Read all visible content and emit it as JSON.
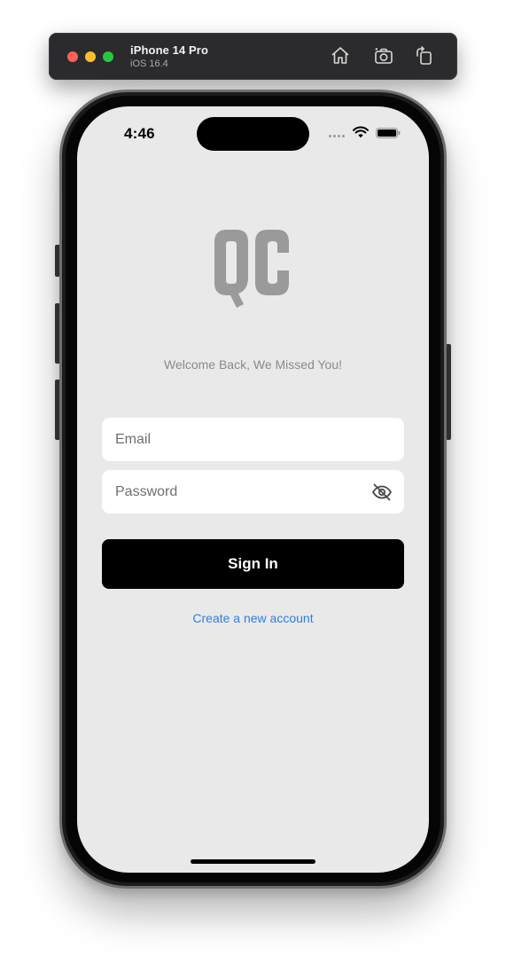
{
  "simulator": {
    "device_name": "iPhone 14 Pro",
    "os_version": "iOS 16.4",
    "tools": [
      "home-icon",
      "screenshot-icon",
      "rotate-icon"
    ]
  },
  "status_bar": {
    "time": "4:46",
    "icons": [
      "wifi-icon",
      "battery-icon"
    ]
  },
  "app": {
    "logo_text": "QC",
    "welcome_text": "Welcome Back, We Missed You!",
    "email": {
      "placeholder": "Email",
      "value": ""
    },
    "password": {
      "placeholder": "Password",
      "value": "",
      "toggle_icon": "eye-slash-icon"
    },
    "sign_in_label": "Sign In",
    "create_account_label": "Create a new account"
  },
  "colors": {
    "screen_background": "#e9e9e9",
    "button_background": "#000000",
    "link": "#2f7fde",
    "welcome_text": "#8a8a8a",
    "logo": "#9a9a9a"
  }
}
